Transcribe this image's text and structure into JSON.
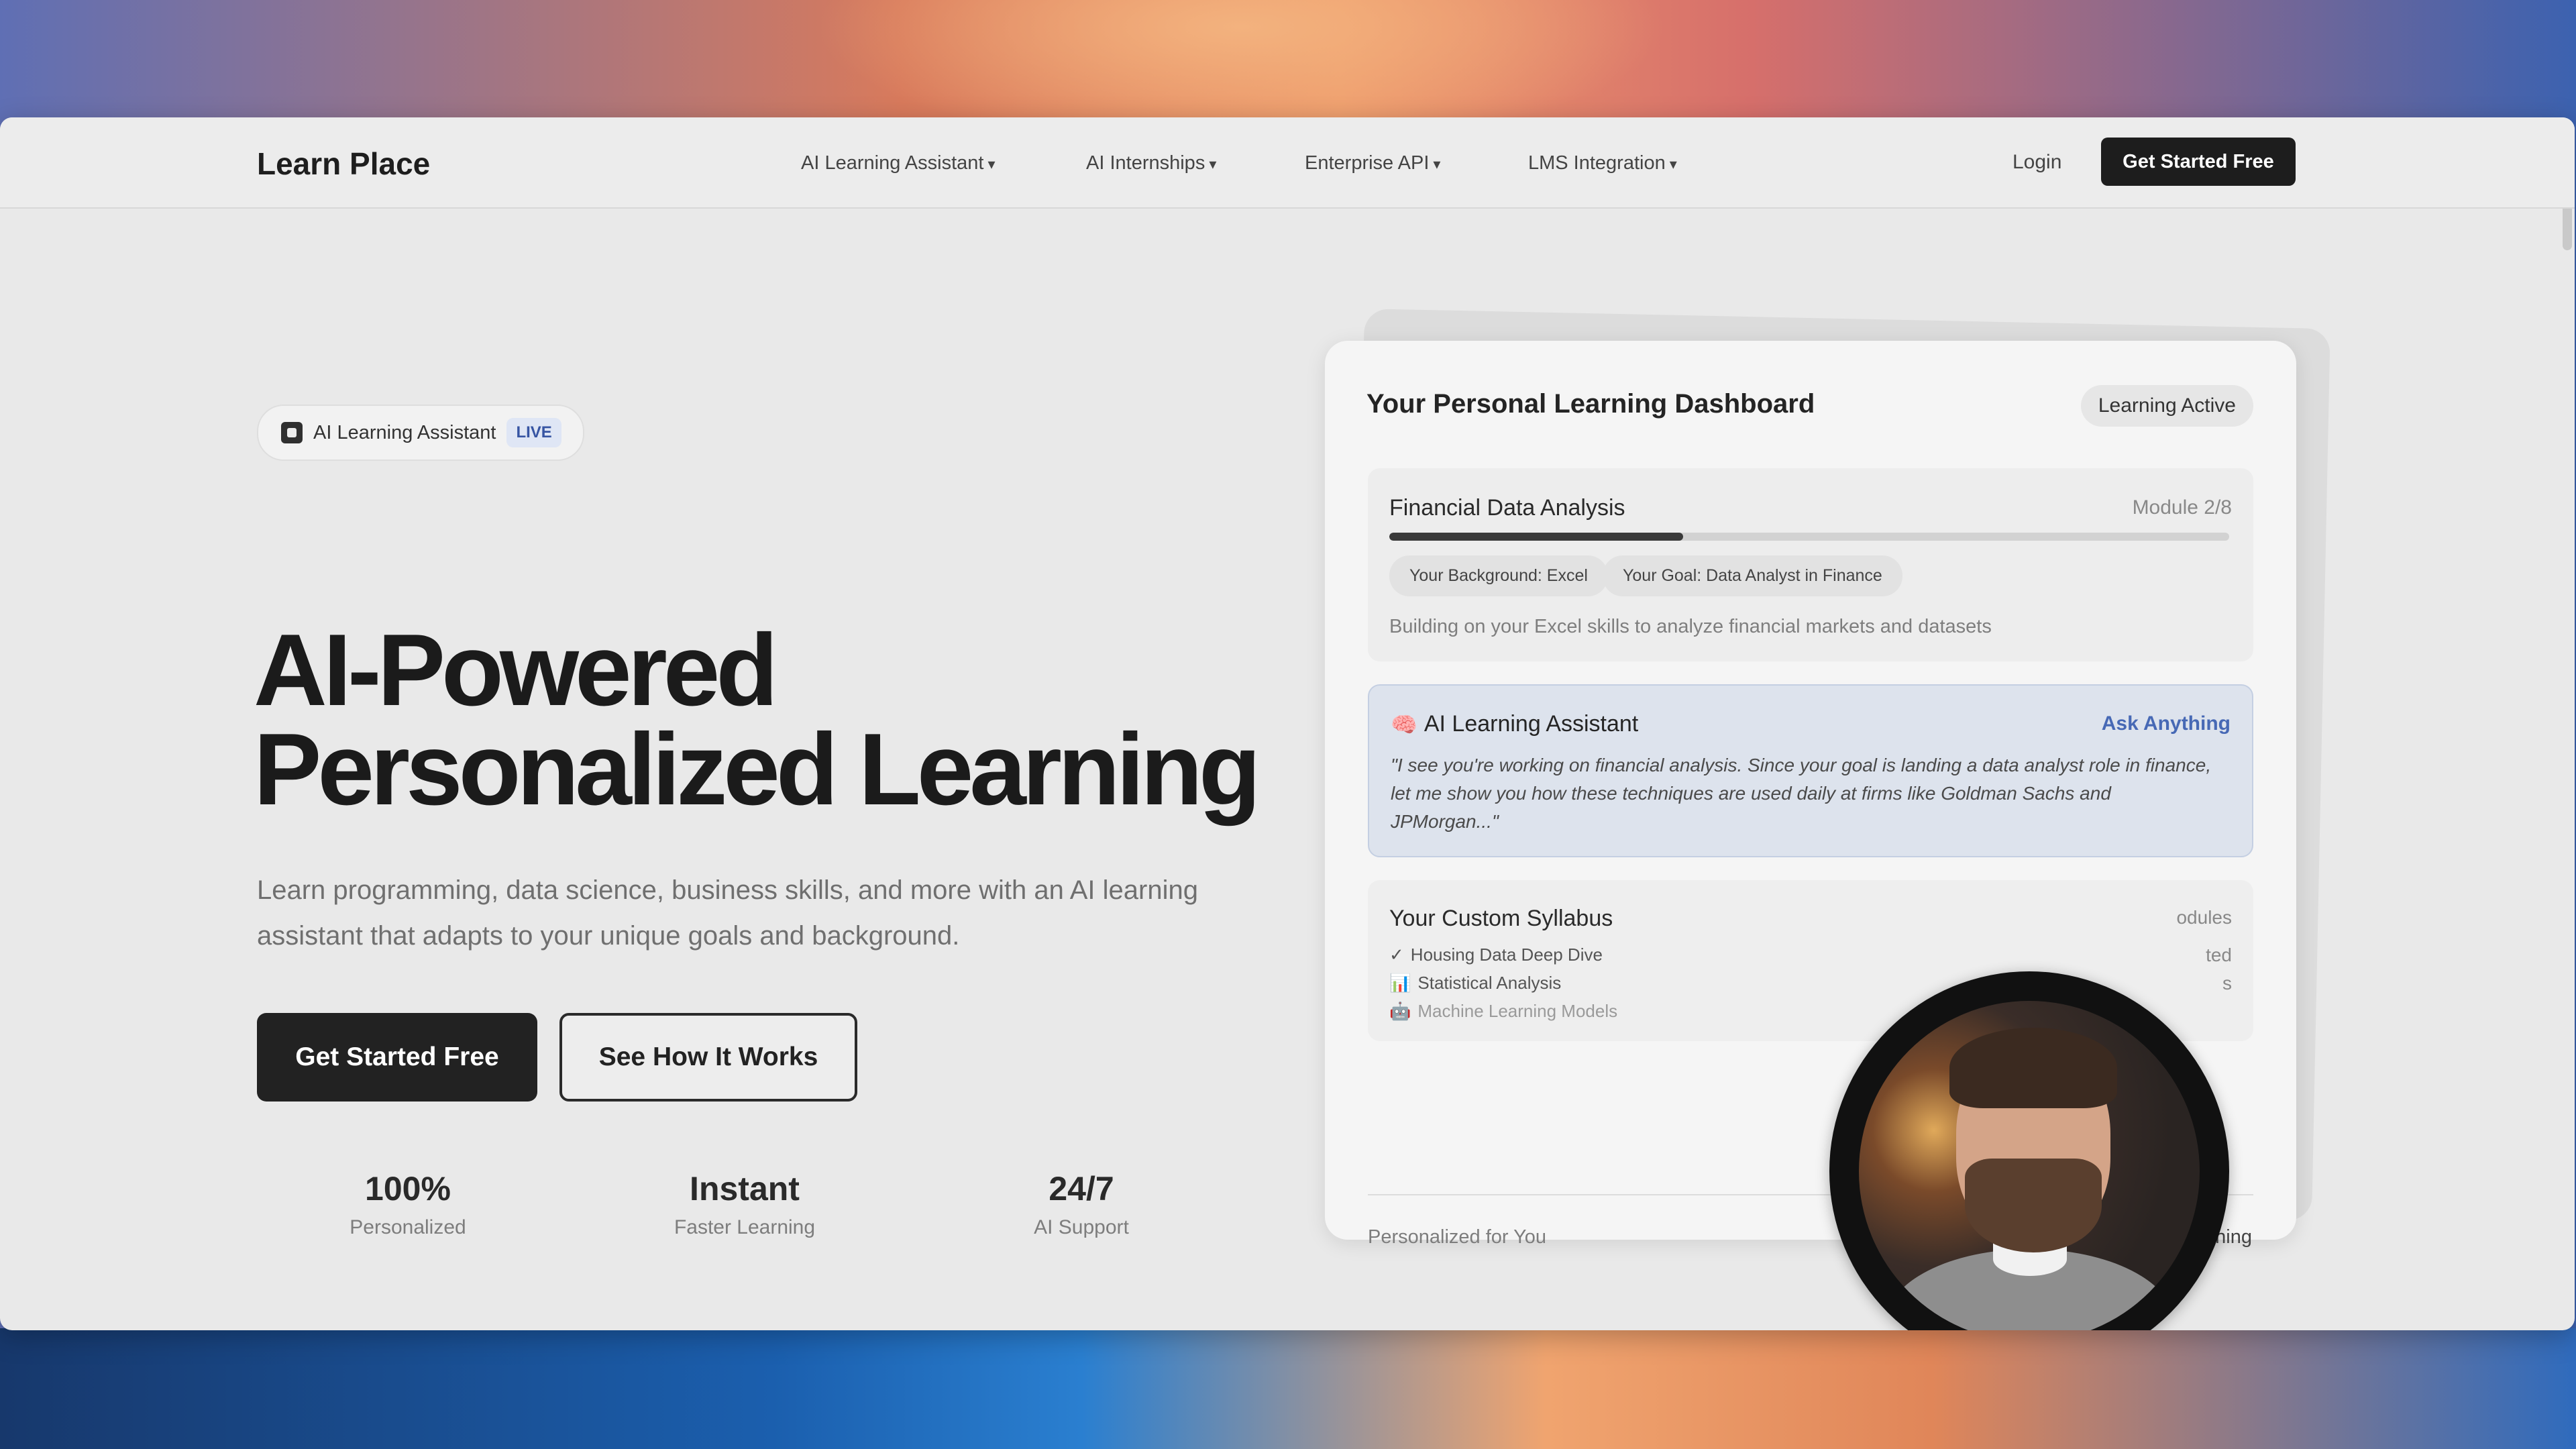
{
  "nav": {
    "brand": "Learn Place",
    "items": [
      {
        "label": "AI Learning Assistant"
      },
      {
        "label": "AI Internships"
      },
      {
        "label": "Enterprise API"
      },
      {
        "label": "LMS Integration"
      }
    ],
    "caret": "▾",
    "login": "Login",
    "cta": "Get Started Free"
  },
  "hero": {
    "badge_label": "AI Learning Assistant",
    "badge_live": "LIVE",
    "title_line1": "AI-Powered",
    "title_line2": "Personalized Learning",
    "subtitle": "Learn programming, data science, business skills, and more with an AI learning assistant that adapts to your unique goals and background.",
    "primary_cta": "Get Started Free",
    "secondary_cta": "See How It Works",
    "stats": [
      {
        "value": "100%",
        "label": "Personalized"
      },
      {
        "value": "Instant",
        "label": "Faster Learning"
      },
      {
        "value": "24/7",
        "label": "AI Support"
      }
    ]
  },
  "dashboard": {
    "title": "Your Personal Learning Dashboard",
    "status": "Learning Active",
    "module": {
      "name": "Financial Data Analysis",
      "count": "Module 2/8",
      "progress": 0.35,
      "tags": [
        "Your Background: Excel",
        "Your Goal: Data Analyst in Finance"
      ],
      "description": "Building on your Excel skills to analyze financial markets and datasets"
    },
    "assistant": {
      "icon": "🧠",
      "title": "AI Learning Assistant",
      "link": "Ask Anything",
      "quote": "\"I see you're working on financial analysis. Since your goal is landing a data analyst role in finance, let me show you how these techniques are used daily at firms like Goldman Sachs and JPMorgan...\""
    },
    "syllabus": {
      "title": "Your Custom Syllabus",
      "items": [
        {
          "icon": "✓",
          "label": "Housing Data Deep Dive"
        },
        {
          "icon": "📊",
          "label": "Statistical Analysis"
        },
        {
          "icon": "🤖",
          "label": "Machine Learning Models"
        }
      ],
      "right_top": "odules",
      "right_mid": "ted",
      "right_low": "s"
    },
    "footer_left": "Personalized for You",
    "footer_right": "ning"
  },
  "colors": {
    "accent": "#4769b5",
    "dark": "#1d1d1d",
    "live_bg": "#dfe6f5"
  }
}
